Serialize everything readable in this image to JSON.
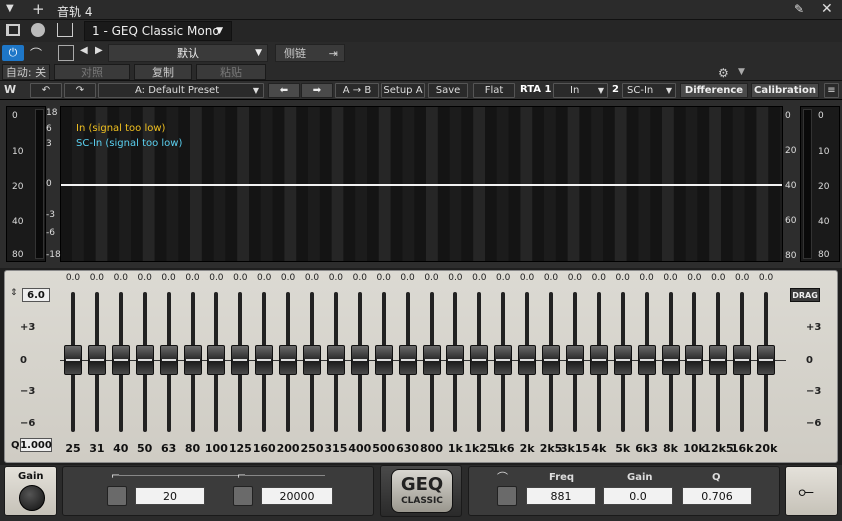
{
  "host": {
    "track_title": "音轨 4",
    "preset_slot": "1 - GEQ Classic Mono",
    "preset_default": "默认",
    "sidechain": "侧链",
    "auto_off": "自动: 关",
    "compare": "对照",
    "copy": "复制",
    "paste": "粘贴"
  },
  "toolbar": {
    "preset_name": "A: Default Preset",
    "ab_label": "A → B",
    "setup_label": "Setup A",
    "save_label": "Save",
    "flat_label": "Flat",
    "rta1_label": "RTA 1",
    "rta1_value": "In",
    "rta2_label": "2",
    "rta2_value": "SC-In",
    "difference_label": "Difference",
    "calibration_label": "Calibration"
  },
  "rta": {
    "legend_in": "In   (signal too low)",
    "legend_sc": "SC-In   (signal too low)",
    "left_scale": [
      "18",
      "6",
      "3",
      "0",
      "-3",
      "-6",
      "-18"
    ],
    "right_scale": [
      "0",
      "20",
      "40",
      "60",
      "80"
    ],
    "meter_scale": [
      "0",
      "10",
      "20",
      "40",
      "80"
    ]
  },
  "eq": {
    "range_value": "6.0",
    "q_label": "Q",
    "q_value": "1.000",
    "drag_label": "DRAG",
    "scale": [
      "+3",
      "0",
      "−3",
      "−6"
    ],
    "bands": [
      {
        "freq": "25",
        "gain": "0.0"
      },
      {
        "freq": "31",
        "gain": "0.0"
      },
      {
        "freq": "40",
        "gain": "0.0"
      },
      {
        "freq": "50",
        "gain": "0.0"
      },
      {
        "freq": "63",
        "gain": "0.0"
      },
      {
        "freq": "80",
        "gain": "0.0"
      },
      {
        "freq": "100",
        "gain": "0.0"
      },
      {
        "freq": "125",
        "gain": "0.0"
      },
      {
        "freq": "160",
        "gain": "0.0"
      },
      {
        "freq": "200",
        "gain": "0.0"
      },
      {
        "freq": "250",
        "gain": "0.0"
      },
      {
        "freq": "315",
        "gain": "0.0"
      },
      {
        "freq": "400",
        "gain": "0.0"
      },
      {
        "freq": "500",
        "gain": "0.0"
      },
      {
        "freq": "630",
        "gain": "0.0"
      },
      {
        "freq": "800",
        "gain": "0.0"
      },
      {
        "freq": "1k",
        "gain": "0.0"
      },
      {
        "freq": "1k25",
        "gain": "0.0"
      },
      {
        "freq": "1k6",
        "gain": "0.0"
      },
      {
        "freq": "2k",
        "gain": "0.0"
      },
      {
        "freq": "2k5",
        "gain": "0.0"
      },
      {
        "freq": "3k15",
        "gain": "0.0"
      },
      {
        "freq": "4k",
        "gain": "0.0"
      },
      {
        "freq": "5k",
        "gain": "0.0"
      },
      {
        "freq": "6k3",
        "gain": "0.0"
      },
      {
        "freq": "8k",
        "gain": "0.0"
      },
      {
        "freq": "10k",
        "gain": "0.0"
      },
      {
        "freq": "12k5",
        "gain": "0.0"
      },
      {
        "freq": "16k",
        "gain": "0.0"
      },
      {
        "freq": "20k",
        "gain": "0.0"
      }
    ]
  },
  "bottom": {
    "gain_label": "Gain",
    "hp_value": "20",
    "lp_value": "20000",
    "logo_top": "GEQ",
    "logo_bottom": "CLASSIC",
    "freq_label": "Freq",
    "gain2_label": "Gain",
    "q_label": "Q",
    "freq_value": "881",
    "gain_value": "0.0",
    "q_value": "0.706"
  }
}
